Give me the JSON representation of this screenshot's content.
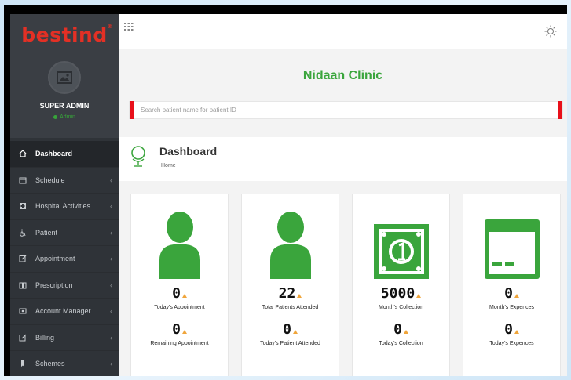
{
  "brand": {
    "logo_text": "bestind",
    "logo_mark": "®",
    "color": "#e33025"
  },
  "profile": {
    "name": "SUPER ADMIN",
    "status": "Admin"
  },
  "nav": {
    "items": [
      {
        "label": "Dashboard",
        "icon": "home-icon"
      },
      {
        "label": "Schedule",
        "icon": "calendar-icon"
      },
      {
        "label": "Hospital Activities",
        "icon": "hospital-icon"
      },
      {
        "label": "Patient",
        "icon": "wheelchair-icon"
      },
      {
        "label": "Appointment",
        "icon": "edit-icon"
      },
      {
        "label": "Prescription",
        "icon": "book-icon"
      },
      {
        "label": "Account Manager",
        "icon": "card-icon"
      },
      {
        "label": "Billing",
        "icon": "edit-icon"
      },
      {
        "label": "Schemes",
        "icon": "shield-icon"
      }
    ]
  },
  "header": {
    "clinic_name": "Nidaan Clinic"
  },
  "search": {
    "placeholder": "Search patient name for patient ID"
  },
  "page": {
    "title": "Dashboard",
    "breadcrumb": "Home"
  },
  "cards": [
    {
      "icon": "person-icon",
      "value": "0",
      "label": "Today's Appointment",
      "value2": "0",
      "label2": "Remaining Appointment"
    },
    {
      "icon": "person-icon",
      "value": "22",
      "label": "Total Patients Attended",
      "value2": "0",
      "label2": "Today's Patient Attended"
    },
    {
      "icon": "money-icon",
      "value": "5000",
      "label": "Month's Collection",
      "value2": "0",
      "label2": "Today's Collection"
    },
    {
      "icon": "credit-card-icon",
      "value": "0",
      "label": "Month's Expences",
      "value2": "0",
      "label2": "Today's Expences"
    }
  ],
  "colors": {
    "accent_green": "#3aa53c",
    "sidebar": "#2f3338",
    "red_marker": "#e8101a"
  }
}
